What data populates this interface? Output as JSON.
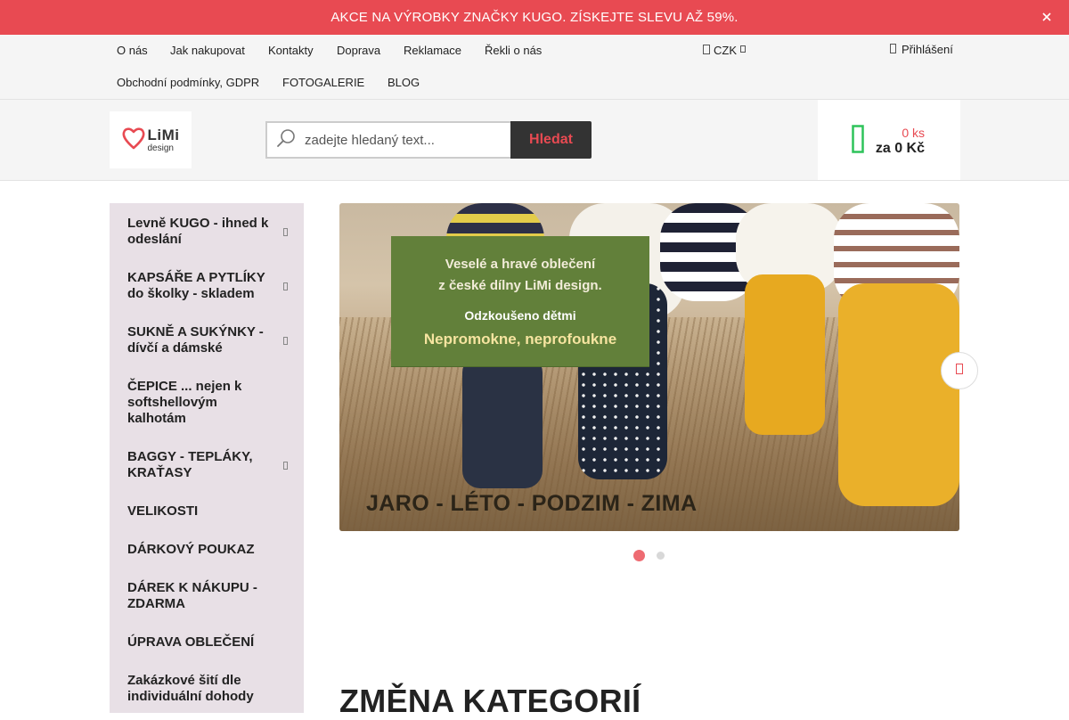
{
  "promo": {
    "text": "AKCE NA VÝROBKY ZNAČKY KUGO. ZÍSKEJTE SLEVU AŽ 59%.",
    "close_icon": "close-icon"
  },
  "topnav": {
    "links": [
      "O nás",
      "Jak nakupovat",
      "Kontakty",
      "Doprava",
      "Reklamace",
      "Řekli o nás",
      "Obchodní podmínky, GDPR",
      "FOTOGALERIE",
      "BLOG"
    ],
    "currency": "CZK",
    "login": "Přihlášení"
  },
  "header": {
    "logo_main": "LiMi",
    "logo_sub": "design",
    "search_placeholder": "zadejte hledaný text...",
    "search_button": "Hledat",
    "cart_count": "0 ks",
    "cart_total": "za 0 Kč"
  },
  "sidebar": {
    "categories": [
      {
        "label": "Levně KUGO - ihned k odeslání",
        "has_arrow": true
      },
      {
        "label": "KAPSÁŘE A PYTLÍKY do školky - skladem",
        "has_arrow": true
      },
      {
        "label": "SUKNĚ A SUKÝNKY - dívčí a dámské",
        "has_arrow": true
      },
      {
        "label": "ČEPICE ... nejen k softshellovým kalhotám",
        "has_arrow": false
      },
      {
        "label": "BAGGY - TEPLÁKY, KRAŤASY",
        "has_arrow": true
      },
      {
        "label": "VELIKOSTI",
        "has_arrow": false
      },
      {
        "label": "DÁRKOVÝ POUKAZ",
        "has_arrow": false
      },
      {
        "label": "DÁREK K NÁKUPU - ZDARMA",
        "has_arrow": false
      },
      {
        "label": "ÚPRAVA OBLEČENÍ",
        "has_arrow": false
      },
      {
        "label": "Zakázkové šití dle individuální dohody",
        "has_arrow": false
      }
    ]
  },
  "slider": {
    "card_line1": "Veselé a hravé oblečení",
    "card_line2": "z české dílny LiMi design.",
    "card_line3": "Odzkoušeno dětmi",
    "card_line4": "Nepromokne, neprofoukne",
    "caption": "JARO - LÉTO - PODZIM - ZIMA",
    "active_slide": 1,
    "total_slides": 2
  },
  "main": {
    "section_title": "ZMĚNA KATEGORIÍ"
  },
  "colors": {
    "accent": "#e84a52",
    "sidebar_bg": "#e8e0e6",
    "cart_green": "#2ec35a",
    "card_green": "#62803a"
  }
}
